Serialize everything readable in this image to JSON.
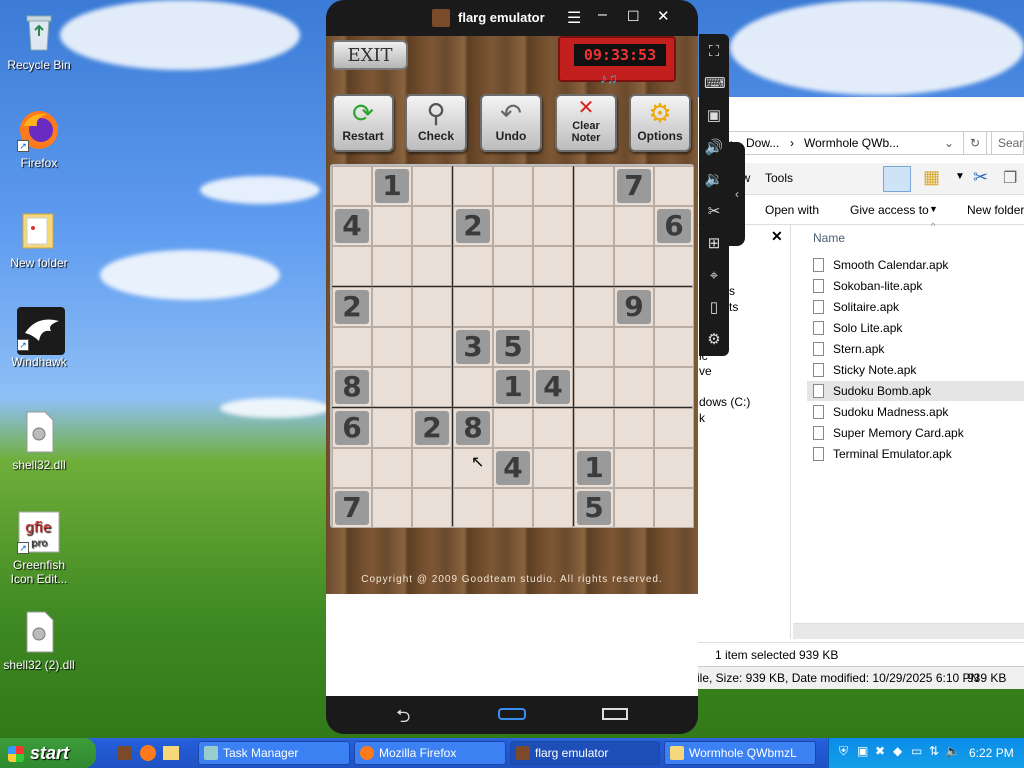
{
  "desktop": {
    "icons": [
      {
        "label": "Recycle Bin"
      },
      {
        "label": "Firefox"
      },
      {
        "label": "New folder"
      },
      {
        "label": "Windhawk"
      },
      {
        "label": "shell32.dll"
      },
      {
        "label": "Greenfish Icon Edit..."
      },
      {
        "label": "shell32 (2).dll"
      }
    ]
  },
  "emulator": {
    "title": "flarg emulator",
    "timer": "09:33:53",
    "exit_label": "EXIT",
    "tools": [
      {
        "label": "Restart"
      },
      {
        "label": "Check"
      },
      {
        "label": "Undo"
      },
      {
        "label": "Clear Noter"
      },
      {
        "label": "Options"
      }
    ],
    "board": [
      [
        "",
        "1",
        "",
        "",
        "",
        "",
        "",
        "7",
        ""
      ],
      [
        "4",
        "",
        "",
        "2",
        "",
        "",
        "",
        "",
        "6"
      ],
      [
        "",
        "",
        "",
        "",
        "",
        "",
        "",
        "",
        ""
      ],
      [
        "2",
        "",
        "",
        "",
        "",
        "",
        "",
        "9",
        ""
      ],
      [
        "",
        "",
        "",
        "3",
        "5",
        "",
        "",
        "",
        ""
      ],
      [
        "8",
        "",
        "",
        "",
        "1",
        "4",
        "",
        "",
        ""
      ],
      [
        "6",
        "",
        "2",
        "8",
        "",
        "",
        "",
        "",
        ""
      ],
      [
        "",
        "",
        "",
        "",
        "4",
        "",
        "1",
        "",
        ""
      ],
      [
        "7",
        "",
        "",
        "",
        "",
        "",
        "5",
        "",
        ""
      ]
    ],
    "copyright": "Copyright @ 2009 Goodteam studio. All rights reserved."
  },
  "explorer": {
    "breadcrumb1": "Dow...",
    "breadcrumb2": "Wormhole QWb...",
    "search_placeholder": "Sear",
    "menu_view": "ew",
    "menu_tools": "Tools",
    "ribbon": {
      "open_with": "Open with",
      "give_access": "Give access to",
      "new_folder": "New folder"
    },
    "column_name": "Name",
    "nav_items": [
      "s",
      "ts",
      "ic",
      "ve",
      "dows (C:)",
      "k"
    ],
    "files": [
      "Smooth Calendar.apk",
      "Sokoban-lite.apk",
      "Solitaire.apk",
      "Solo Lite.apk",
      "Stern.apk",
      "Sticky Note.apk",
      "Sudoku Bomb.apk",
      "Sudoku Madness.apk",
      "Super Memory Card.apk",
      "Terminal Emulator.apk"
    ],
    "status_selected": "1 item selected",
    "status_size": "939 KB",
    "status_detail": "ile, Size: 939 KB, Date modified: 10/29/2025 6:10 PN",
    "status_size2": "939 KB"
  },
  "taskbar": {
    "start_label": "start",
    "buttons": [
      {
        "label": "Task Manager"
      },
      {
        "label": "Mozilla Firefox"
      },
      {
        "label": "flarg emulator"
      },
      {
        "label": "Wormhole QWbmzL"
      }
    ],
    "clock": "6:22 PM"
  }
}
